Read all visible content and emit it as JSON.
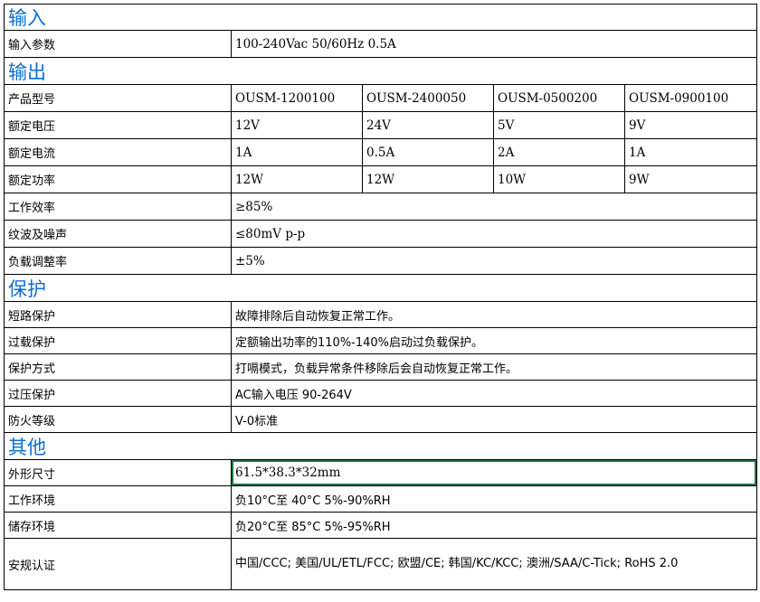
{
  "sections": {
    "input": "输入",
    "output": "输出",
    "protection": "保护",
    "other": "其他"
  },
  "input": {
    "param_label": "输入参数",
    "param_value": "100-240Vac 50/60Hz 0.5A"
  },
  "output": {
    "model_label": "产品型号",
    "models": [
      "OUSM-1200100",
      "OUSM-2400050",
      "OUSM-0500200",
      "OUSM-0900100"
    ],
    "voltage_label": "额定电压",
    "voltages": [
      "12V",
      "24V",
      "5V",
      "9V"
    ],
    "current_label": "额定电流",
    "currents": [
      "1A",
      "0.5A",
      "2A",
      "1A"
    ],
    "power_label": "额定功率",
    "powers": [
      "12W",
      "12W",
      "10W",
      "9W"
    ],
    "efficiency_label": "工作效率",
    "efficiency_value": "≥85%",
    "ripple_label": "纹波及噪声",
    "ripple_value": "≤80mV p-p",
    "load_reg_label": "负载调整率",
    "load_reg_value": "±5%"
  },
  "protection": {
    "short_label": "短路保护",
    "short_value": "故障排除后自动恢复正常工作。",
    "overload_label": "过载保护",
    "overload_value": "定额输出功率的110%-140%启动过负载保护。",
    "mode_label": "保护方式",
    "mode_value": "打嗝模式，负载异常条件移除后会自动恢复正常工作。",
    "overvoltage_label": "过压保护",
    "overvoltage_value": "AC输入电压 90-264V",
    "fire_label": "防火等级",
    "fire_value": "V-0标准"
  },
  "other": {
    "size_label": "外形尺寸",
    "size_value": "61.5*38.3*32mm",
    "op_env_label": "工作环境",
    "op_env_value": "负10°C至 40°C  5%-90%RH",
    "storage_label": "储存环境",
    "storage_value": "负20°C至 85°C  5%-95%RH",
    "cert_label": "安规认证",
    "cert_value": "中国/CCC; 美国/UL/ETL/FCC; 欧盟/CE; 韩国/KC/KCC;  澳洲/SAA/C-Tick; RoHS 2.0"
  },
  "colors": {
    "section_title": "#0b6fd6",
    "grid": "#000000",
    "selection": "#217346"
  }
}
